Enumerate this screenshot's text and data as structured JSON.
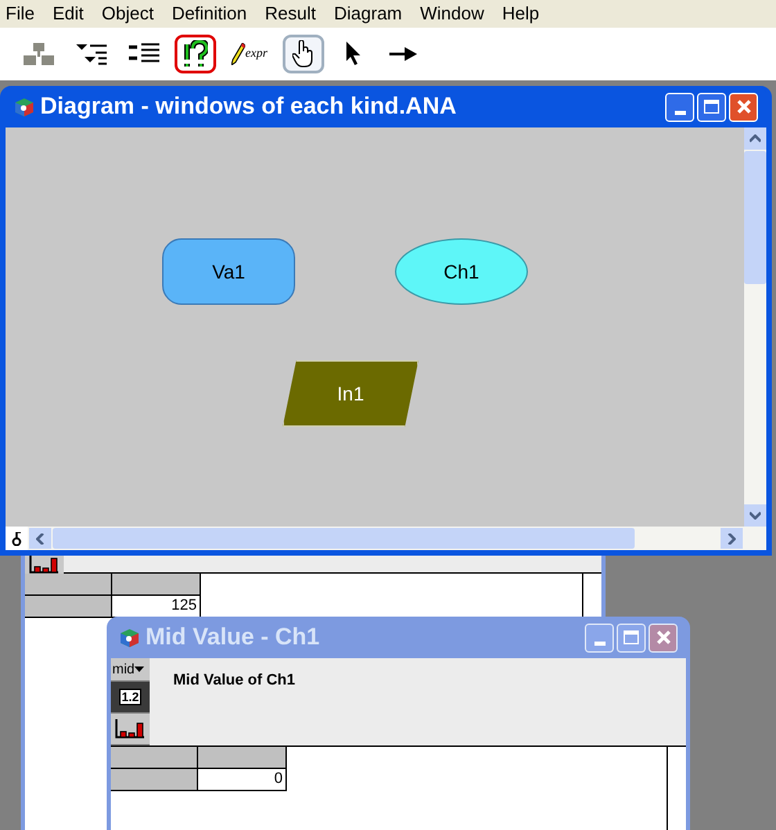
{
  "menu": [
    "File",
    "Edit",
    "Object",
    "Definition",
    "Result",
    "Diagram",
    "Window",
    "Help"
  ],
  "toolbar": [
    {
      "kind": "hierarchy",
      "selected": false,
      "highlighted": false
    },
    {
      "kind": "outline",
      "selected": false,
      "highlighted": false
    },
    {
      "kind": "list",
      "selected": false,
      "highlighted": false
    },
    {
      "kind": "help",
      "selected": false,
      "highlighted": true
    },
    {
      "kind": "expr",
      "label": "expr",
      "selected": false,
      "highlighted": false
    },
    {
      "kind": "hand",
      "selected": true,
      "highlighted": false
    },
    {
      "kind": "pointer",
      "selected": false,
      "highlighted": false
    },
    {
      "kind": "arrow",
      "selected": false,
      "highlighted": false
    }
  ],
  "diagram_window": {
    "title": "Diagram - windows of each kind.ANA",
    "active": true,
    "nodes": [
      {
        "kind": "variable",
        "label": "Va1"
      },
      {
        "kind": "chance",
        "label": "Ch1"
      },
      {
        "kind": "index",
        "label": "In1"
      }
    ]
  },
  "back_window": {
    "active": false,
    "value": "125"
  },
  "mid_window": {
    "title": "Mid Value - Ch1",
    "active": false,
    "index_menu": "mid",
    "number_format": "1.2",
    "heading": "Mid Value of Ch1",
    "value": "0"
  }
}
